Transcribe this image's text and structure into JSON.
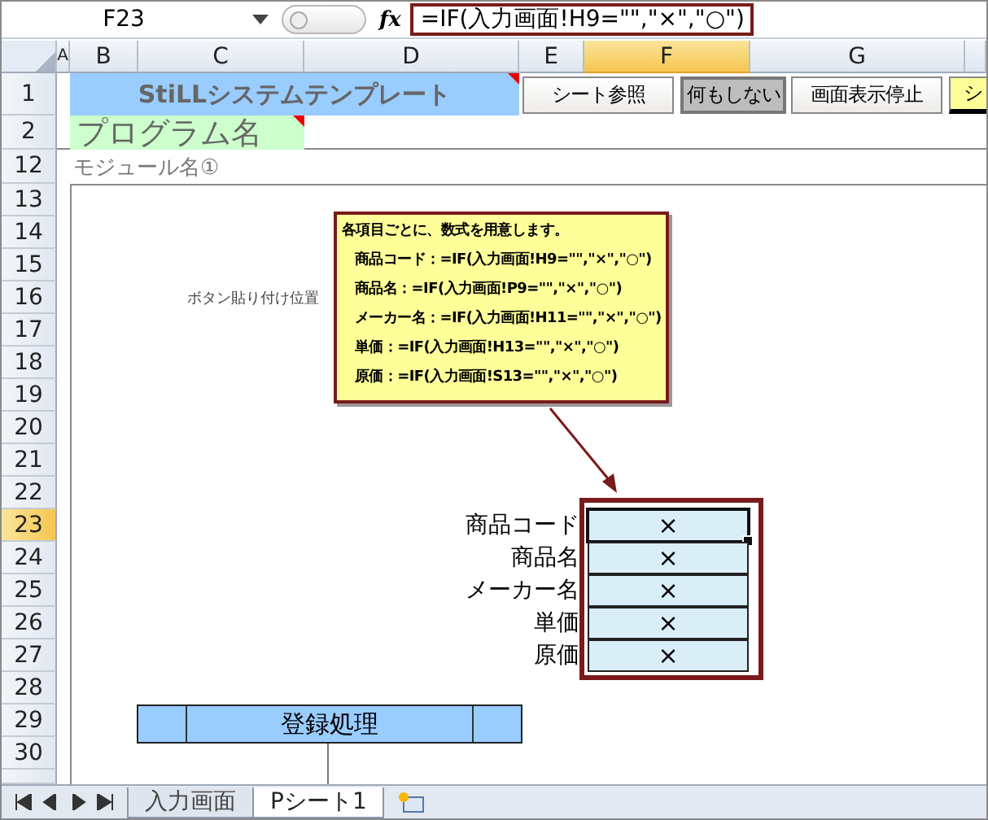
{
  "formula_bar": {
    "name_box": "F23",
    "fx": "fx",
    "formula": "=IF(入力画面!H9=\"\",\"×\",\"○\")"
  },
  "columns": [
    {
      "label": "A",
      "selected": false
    },
    {
      "label": "B",
      "selected": false
    },
    {
      "label": "C",
      "selected": false
    },
    {
      "label": "D",
      "selected": false
    },
    {
      "label": "E",
      "selected": false
    },
    {
      "label": "F",
      "selected": true
    },
    {
      "label": "G",
      "selected": false
    }
  ],
  "rows": [
    {
      "label": "1",
      "selected": false
    },
    {
      "label": "2",
      "selected": false
    },
    {
      "label": "12",
      "selected": false
    },
    {
      "label": "13",
      "selected": false
    },
    {
      "label": "14",
      "selected": false
    },
    {
      "label": "15",
      "selected": false
    },
    {
      "label": "16",
      "selected": false
    },
    {
      "label": "17",
      "selected": false
    },
    {
      "label": "18",
      "selected": false
    },
    {
      "label": "19",
      "selected": false
    },
    {
      "label": "20",
      "selected": false
    },
    {
      "label": "21",
      "selected": false
    },
    {
      "label": "22",
      "selected": false
    },
    {
      "label": "23",
      "selected": true
    },
    {
      "label": "24",
      "selected": false
    },
    {
      "label": "25",
      "selected": false
    },
    {
      "label": "26",
      "selected": false
    },
    {
      "label": "27",
      "selected": false
    },
    {
      "label": "28",
      "selected": false
    },
    {
      "label": "29",
      "selected": false
    },
    {
      "label": "30",
      "selected": false
    }
  ],
  "cells": {
    "title": "StiLLシステムテンプレート",
    "program_name": "プログラム名",
    "module_name": "モジュール名①",
    "button_area_note": "ボタン貼り付け位置"
  },
  "toolbar_buttons": [
    {
      "label": "シート参照",
      "kind": "button",
      "pressed": false
    },
    {
      "label": "何もしない",
      "kind": "button",
      "pressed": true
    },
    {
      "label": "画面表示停止",
      "kind": "button",
      "pressed": false
    },
    {
      "label": "シ",
      "kind": "highlight",
      "pressed": false
    }
  ],
  "comment": {
    "lines": [
      "各項目ごとに、数式を用意します。",
      "商品コード：=IF(入力画面!H9=\"\",\"×\",\"○\")",
      "商品名：=IF(入力画面!P9=\"\",\"×\",\"○\")",
      "メーカー名：=IF(入力画面!H11=\"\",\"×\",\"○\")",
      "単価：=IF(入力画面!H13=\"\",\"×\",\"○\")",
      "原価：=IF(入力画面!S13=\"\",\"×\",\"○\")"
    ]
  },
  "check_table": [
    {
      "label": "商品コード",
      "value": "×",
      "selected": true
    },
    {
      "label": "商品名",
      "value": "×",
      "selected": false
    },
    {
      "label": "メーカー名",
      "value": "×",
      "selected": false
    },
    {
      "label": "単価",
      "value": "×",
      "selected": false
    },
    {
      "label": "原価",
      "value": "×",
      "selected": false
    }
  ],
  "register_button": {
    "label": "登録処理"
  },
  "sheet_tabs": [
    {
      "label": "入力画面",
      "selected": false
    },
    {
      "label": "Pシート1",
      "selected": true
    }
  ]
}
